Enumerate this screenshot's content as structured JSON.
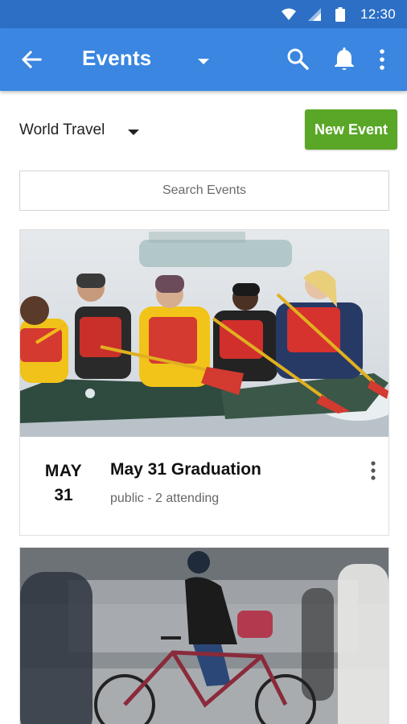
{
  "status_bar": {
    "time": "12:30",
    "icons": [
      "wifi-icon",
      "signal-icon",
      "battery-icon"
    ]
  },
  "app_bar": {
    "title": "Events",
    "icons": [
      "back-arrow-icon",
      "dropdown-icon",
      "search-icon",
      "bell-icon",
      "more-vert-icon"
    ]
  },
  "filter": {
    "group_label": "World Travel"
  },
  "new_event_label": "New Event",
  "search": {
    "placeholder": "Search Events"
  },
  "events": [
    {
      "month": "MAY",
      "day": "31",
      "title": "May 31 Graduation",
      "meta": "public - 2 attending",
      "image": "canoe-group-photo"
    },
    {
      "image": "cyclist-street-photo"
    }
  ],
  "colors": {
    "status_bar": "#2c6fc5",
    "app_bar": "#3a86e0",
    "accent_green": "#5aa627"
  }
}
